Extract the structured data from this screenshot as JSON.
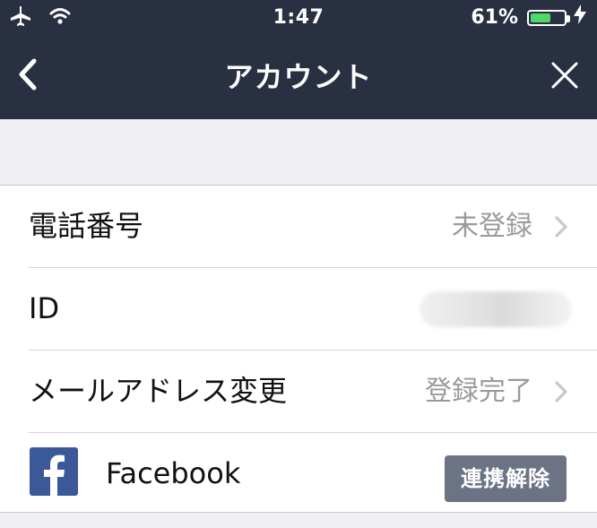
{
  "status_bar": {
    "time": "1:47",
    "battery_text": "61%",
    "battery_level": 0.61,
    "icons": {
      "airplane": "airplane-icon",
      "wifi": "wifi-icon",
      "charging": "charging-bolt-icon"
    },
    "colors": {
      "battery_fill": "#4cd964"
    }
  },
  "nav": {
    "title": "アカウント",
    "back_icon": "back-chevron-icon",
    "close_icon": "close-icon"
  },
  "rows": [
    {
      "label": "電話番号",
      "value": "未登録",
      "icon": "chevron-right-icon"
    },
    {
      "label": "ID",
      "value": "",
      "note": "blurred"
    },
    {
      "label": "メールアドレス変更",
      "value": "登録完了",
      "icon": "chevron-right-icon"
    },
    {
      "label": "Facebook",
      "button_label": "連携解除",
      "icon": "facebook-icon"
    }
  ],
  "colors": {
    "header_bg": "#283042",
    "page_bg": "#efeff4",
    "list_bg": "#ffffff",
    "value_text": "#9a9a9a",
    "facebook_blue": "#3b5998",
    "unlink_button_bg": "#6b7384"
  }
}
